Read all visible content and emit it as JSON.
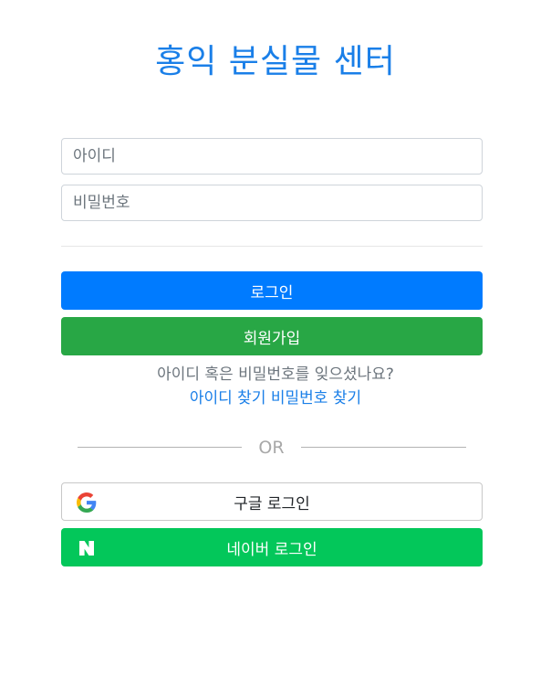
{
  "header": {
    "title": "홍익 분실물 센터"
  },
  "form": {
    "id_placeholder": "아이디",
    "password_placeholder": "비밀번호",
    "login_label": "로그인",
    "signup_label": "회원가입"
  },
  "help": {
    "forgot_text": "아이디 혹은 비밀번호를 잊으셨나요?",
    "find_id_label": "아이디 찾기",
    "find_password_label": "비밀번호 찾기"
  },
  "social": {
    "or_label": "OR",
    "google_label": "구글 로그인",
    "naver_label": "네이버 로그인",
    "google_icon": "google-icon",
    "naver_icon": "naver-icon"
  },
  "colors": {
    "title": "#1a7fe8",
    "login": "#007bff",
    "signup": "#28a745",
    "naver": "#03c75a",
    "link": "#1a7fe8"
  }
}
